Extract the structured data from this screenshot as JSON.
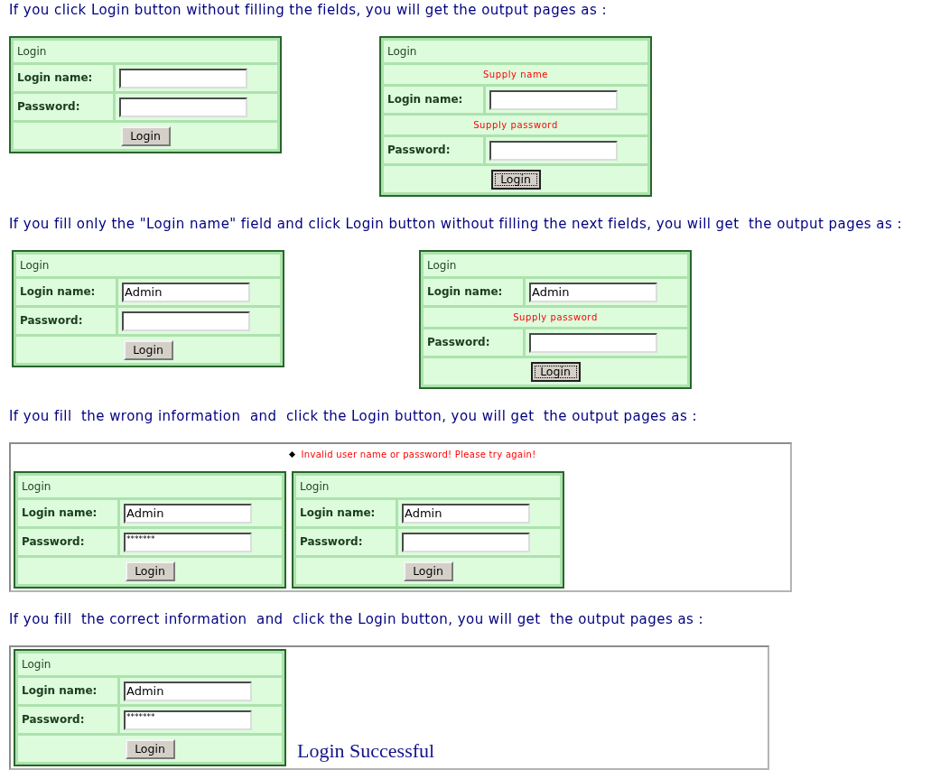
{
  "sections": [
    {
      "heading": "If you click Login button without filling the fields, you will get the output pages as :",
      "kind": "pair",
      "forms": [
        {
          "title": "Login",
          "rows": [
            {
              "kind": "text",
              "label": "Login name:"
            },
            {
              "kind": "password",
              "label": "Password:"
            }
          ],
          "button": {
            "label": "Login",
            "focused": false
          }
        },
        {
          "title": "Login",
          "rows": [
            {
              "kind": "error",
              "text": "Supply name"
            },
            {
              "kind": "text",
              "label": "Login name:"
            },
            {
              "kind": "error",
              "text": "Supply password"
            },
            {
              "kind": "password",
              "label": "Password:"
            }
          ],
          "button": {
            "label": "Login",
            "focused": true
          }
        }
      ]
    },
    {
      "heading": "If you fill only the \"Login name\" field and click Login button without filling the next fields, you will get  the output pages as :",
      "kind": "pair",
      "forms": [
        {
          "title": "Login",
          "rows": [
            {
              "kind": "text",
              "label": "Login name:",
              "value": "Admin"
            },
            {
              "kind": "password",
              "label": "Password:"
            }
          ],
          "button": {
            "label": "Login",
            "focused": false
          }
        },
        {
          "title": "Login",
          "rows": [
            {
              "kind": "text",
              "label": "Login name:",
              "value": "Admin"
            },
            {
              "kind": "error",
              "text": "Supply password"
            },
            {
              "kind": "password",
              "label": "Password:"
            }
          ],
          "button": {
            "label": "Login",
            "focused": true
          }
        }
      ]
    },
    {
      "heading": "If you fill  the wrong information  and  click the Login button, you will get  the output pages as :",
      "kind": "framed",
      "message": "Invalid user name or password! Please try again!",
      "forms": [
        {
          "title": "Login",
          "rows": [
            {
              "kind": "text",
              "label": "Login name:",
              "value": "Admin"
            },
            {
              "kind": "password",
              "label": "Password:",
              "value": "*******"
            }
          ],
          "button": {
            "label": "Login",
            "focused": false
          }
        },
        {
          "title": "Login",
          "rows": [
            {
              "kind": "text",
              "label": "Login name:",
              "value": "Admin"
            },
            {
              "kind": "password",
              "label": "Password:"
            }
          ],
          "button": {
            "label": "Login",
            "focused": false
          }
        }
      ]
    },
    {
      "heading": "If you fill  the correct information  and  click the Login button, you will get  the output pages as :",
      "kind": "framed",
      "forms": [
        {
          "title": "Login",
          "rows": [
            {
              "kind": "text",
              "label": "Login name:",
              "value": "Admin"
            },
            {
              "kind": "password",
              "label": "Password:",
              "value": "*******"
            }
          ],
          "button": {
            "label": "Login",
            "focused": false
          }
        }
      ],
      "result": "Login Successful"
    }
  ]
}
